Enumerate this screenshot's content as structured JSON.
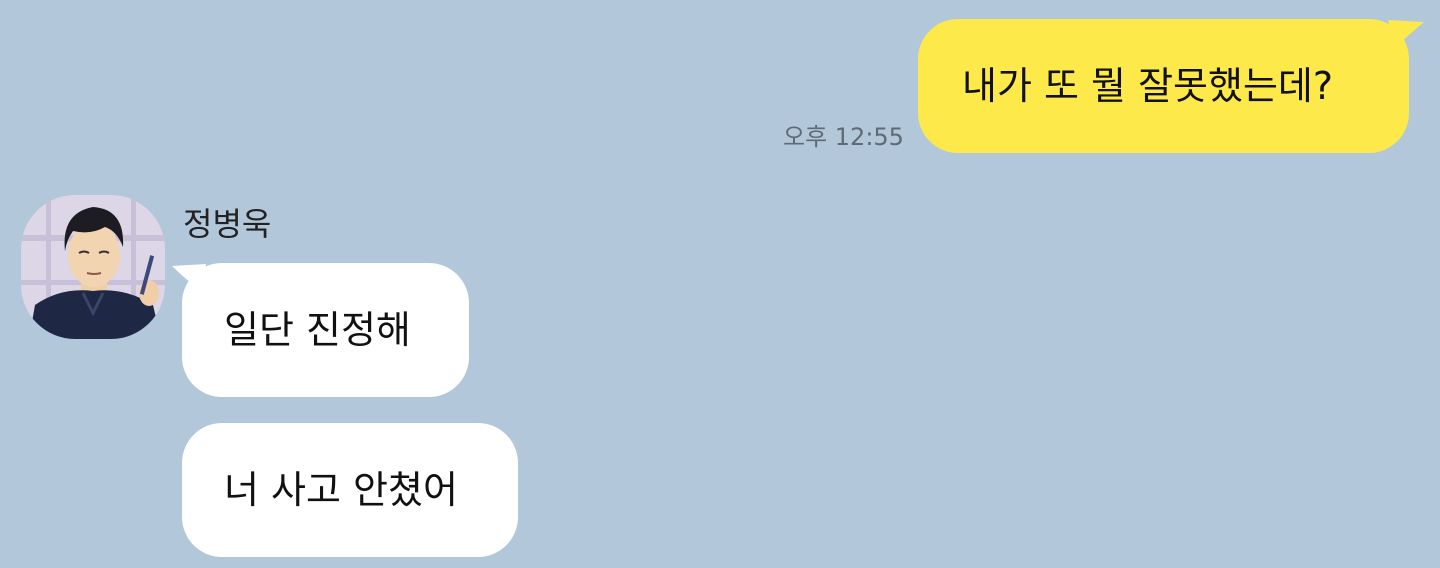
{
  "chat": {
    "outgoing": [
      {
        "text": "내가 또 뭘 잘못했는데?",
        "time": "오후 12:55"
      }
    ],
    "incoming": {
      "sender_name": "정병욱",
      "avatar_icon": "profile-avatar-icon",
      "messages": [
        {
          "text": "일단 진정해"
        },
        {
          "text": "너 사고 안쳤어"
        }
      ]
    }
  },
  "colors": {
    "background": "#b2c7da",
    "outgoing_bubble": "#fee94a",
    "incoming_bubble": "#ffffff",
    "timestamp_text": "#5f6a75"
  }
}
